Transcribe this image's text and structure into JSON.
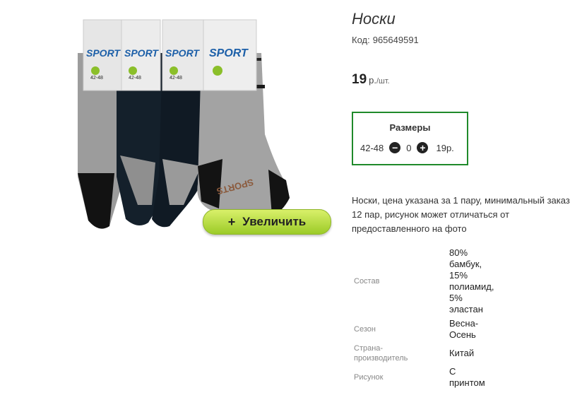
{
  "product": {
    "title": "Носки",
    "code_label": "Код:",
    "code_value": "965649591",
    "price_value": "19",
    "price_currency": "р.",
    "price_per": "/шт.",
    "zoom_button_label": "Увеличить",
    "zoom_button_icon": "plus-icon",
    "description": "Носки, цена указана за 1 пару, минимальный заказ 12 пар, рисунок может отличаться от предоставленного на фото"
  },
  "sizes": {
    "title": "Размеры",
    "rows": [
      {
        "size": "42-48",
        "quantity": "0",
        "price": "19р."
      }
    ]
  },
  "specs": [
    {
      "label": "Состав",
      "value": "80%\nбамбук,\n15%\nполиамид,\n5%\nэластан"
    },
    {
      "label": "Сезон",
      "value": "Весна-\nОсень"
    },
    {
      "label": "Страна-\nпроизводитель",
      "value": "Китай"
    },
    {
      "label": "Рисунок",
      "value": "С\nпринтом"
    }
  ],
  "image": {
    "tag_text": "SPORT",
    "tag_size_text": "42-48",
    "sole_text": "SPORTS",
    "colors": {
      "gray": "#9a9a9a",
      "navy": "#0f1a24",
      "accent_green": "#1f8a2b",
      "button_green": "#b7dd43"
    }
  }
}
